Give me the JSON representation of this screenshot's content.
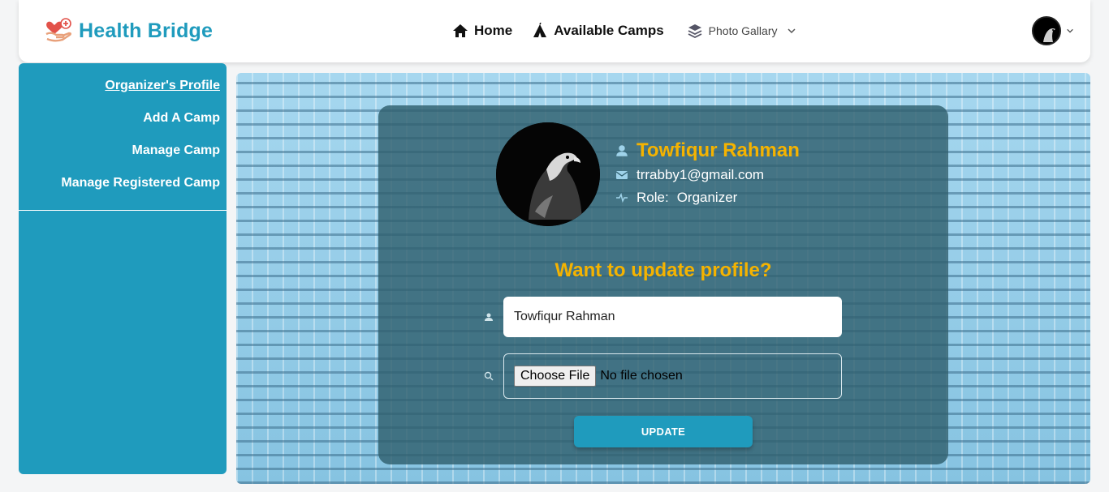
{
  "brand": {
    "name": "Health Bridge",
    "icon": "heart-hand-icon",
    "color": "#1f9bbd"
  },
  "nav": {
    "home": {
      "label": "Home",
      "icon": "home-icon"
    },
    "camps": {
      "label": "Available Camps",
      "icon": "tent-icon"
    },
    "gallery": {
      "label": "Photo Gallary",
      "icon": "layers-icon"
    }
  },
  "sidebar": {
    "items": [
      {
        "label": "Organizer's Profile",
        "active": true
      },
      {
        "label": "Add A Camp",
        "active": false
      },
      {
        "label": "Manage Camp",
        "active": false
      },
      {
        "label": "Manage Registered Camp",
        "active": false
      }
    ]
  },
  "profile": {
    "name": "Towfiqur Rahman",
    "email": "trrabby1@gmail.com",
    "role_label": "Role:",
    "role": "Organizer"
  },
  "update_form": {
    "title": "Want to update profile?",
    "name_value": "Towfiqur Rahman",
    "file_button": "Choose File",
    "file_status": "No file chosen",
    "submit_label": "UPDATE"
  },
  "colors": {
    "accent": "#1f9bbd",
    "highlight": "#f5b300"
  }
}
